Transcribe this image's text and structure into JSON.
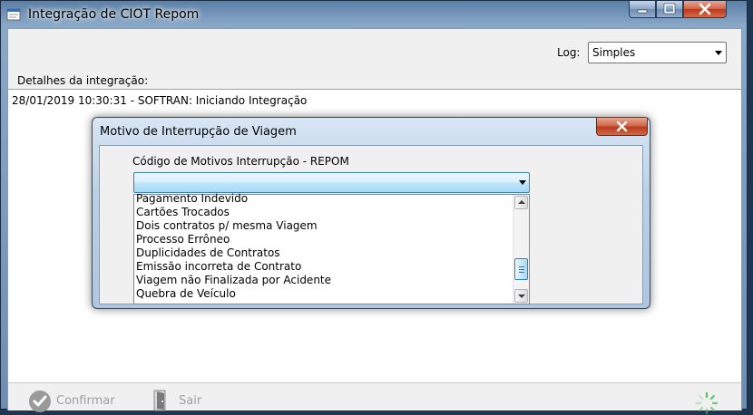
{
  "window": {
    "title": "Integração de CIOT Repom"
  },
  "log": {
    "label": "Log:",
    "selected": "Simples"
  },
  "details": {
    "label": "Detalhes da integração:",
    "lines": [
      "28/01/2019 10:30:31 - SOFTRAN: Iniciando Integração"
    ]
  },
  "footer": {
    "confirm_label": "Confirmar",
    "exit_label": "Sair"
  },
  "dialog": {
    "title": "Motivo de Interrupção de Viagem",
    "field_label": "Código de Motivos  Interrupção - REPOM",
    "selected": "",
    "options": [
      "Pagamento Indevido",
      "Cartões Trocados",
      "Dois contratos p/ mesma Viagem",
      "Processo Errôneo",
      "Duplicidades de Contratos",
      "Emissão incorreta de Contrato",
      "Viagem não Finalizada por Acidente",
      "Quebra de Veículo"
    ]
  },
  "colors": {
    "accent": "#3c7fb1",
    "close": "#c4472a",
    "disabled_text": "#a0a0a0",
    "spinner": "#5cc46c"
  }
}
